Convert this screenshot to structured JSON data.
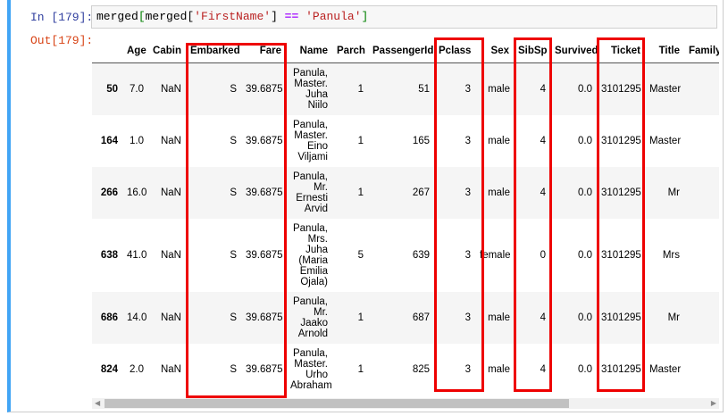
{
  "cell": {
    "in_prompt": "In [179]:",
    "out_prompt": "Out[179]:",
    "code": {
      "p1": "merged",
      "p2": "[",
      "p3": "merged[",
      "p4": "'FirstName'",
      "p5": "]",
      "p6": " == ",
      "p7": "'Panula'",
      "p8": "]"
    }
  },
  "table": {
    "columns": [
      "",
      "Age",
      "Cabin",
      "Embarked",
      "Fare",
      "Name",
      "Parch",
      "PassengerId",
      "Pclass",
      "Sex",
      "SibSp",
      "Survived",
      "Ticket",
      "Title",
      "Family"
    ],
    "rows": [
      [
        "50",
        "7.0",
        "NaN",
        "S",
        "39.6875",
        "Panula, Master. Juha Niilo",
        "1",
        "51",
        "3",
        "male",
        "4",
        "0.0",
        "3101295",
        "Master",
        ""
      ],
      [
        "164",
        "1.0",
        "NaN",
        "S",
        "39.6875",
        "Panula, Master. Eino Viljami",
        "1",
        "165",
        "3",
        "male",
        "4",
        "0.0",
        "3101295",
        "Master",
        ""
      ],
      [
        "266",
        "16.0",
        "NaN",
        "S",
        "39.6875",
        "Panula, Mr. Ernesti Arvid",
        "1",
        "267",
        "3",
        "male",
        "4",
        "0.0",
        "3101295",
        "Mr",
        ""
      ],
      [
        "638",
        "41.0",
        "NaN",
        "S",
        "39.6875",
        "Panula, Mrs. Juha (Maria Emilia Ojala)",
        "5",
        "639",
        "3",
        "female",
        "0",
        "0.0",
        "3101295",
        "Mrs",
        ""
      ],
      [
        "686",
        "14.0",
        "NaN",
        "S",
        "39.6875",
        "Panula, Mr. Jaako Arnold",
        "1",
        "687",
        "3",
        "male",
        "4",
        "0.0",
        "3101295",
        "Mr",
        ""
      ],
      [
        "824",
        "2.0",
        "NaN",
        "S",
        "39.6875",
        "Panula, Master. Urho Abraham",
        "1",
        "825",
        "3",
        "male",
        "4",
        "0.0",
        "3101295",
        "Master",
        ""
      ]
    ]
  },
  "highlight_color": "#e00000",
  "highlighted_columns": [
    "Embarked",
    "Fare",
    "Pclass",
    "SibSp",
    "Ticket"
  ],
  "scrollbar": {
    "left_icon": "triangle-left-icon",
    "right_icon": "triangle-right-icon"
  }
}
